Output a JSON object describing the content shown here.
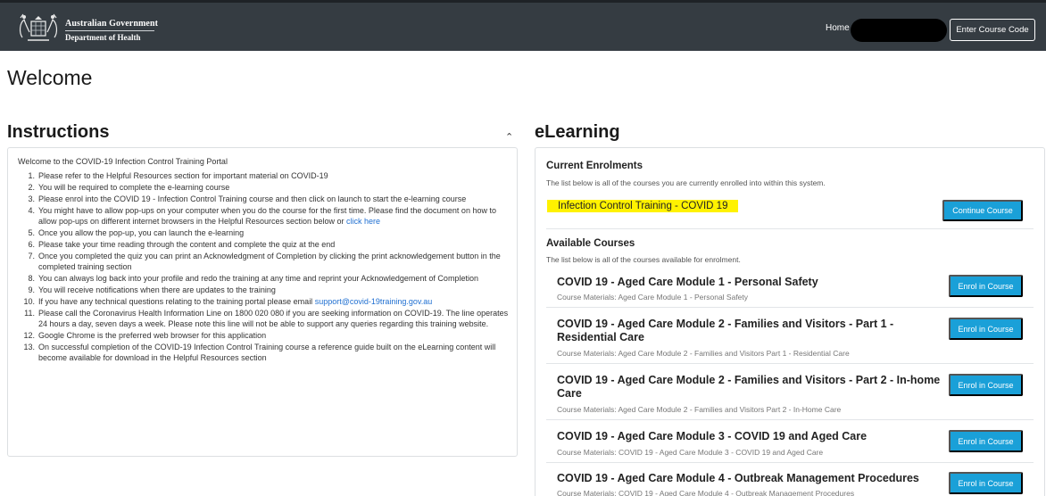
{
  "header": {
    "gov_line1": "Australian Government",
    "gov_line2": "Department of Health",
    "home_label": "Home",
    "enter_code_label": "Enter Course Code"
  },
  "page_title": "Welcome",
  "instructions": {
    "title": "Instructions",
    "collapse_icon": "chevron-up",
    "intro": "Welcome to the COVID-19 Infection Control Training Portal",
    "items": [
      {
        "num": "1.",
        "text": "Please refer to the Helpful Resources section for important material on COVID-19"
      },
      {
        "num": "2.",
        "text": "You will be required to complete the e-learning course"
      },
      {
        "num": "3.",
        "text": "Please enrol into the COVID 19 - Infection Control Training course and then click on launch to start the e-learning course"
      },
      {
        "num": "4.",
        "text": "You might have to allow pop-ups on your computer when you do the course for the first time. Please find the document on how to allow pop-ups on different internet browsers in the Helpful Resources section below or ",
        "link": "click here"
      },
      {
        "num": "5.",
        "text": "Once you allow the pop-up, you can launch the e-learning"
      },
      {
        "num": "6.",
        "text": "Please take your time reading through the content and complete the quiz at the end"
      },
      {
        "num": "7.",
        "text": "Once you completed the quiz you can print an Acknowledgment of Completion by clicking the print acknowledgement button in the completed training section"
      },
      {
        "num": "8.",
        "text": "You can always log back into your profile and redo the training at any time and reprint your Acknowledgement of Completion"
      },
      {
        "num": "9.",
        "text": "You will receive notifications when there are updates to the training"
      },
      {
        "num": "10.",
        "text": "If you have any technical questions relating to the training portal please email ",
        "link": "support@covid-19training.gov.au"
      },
      {
        "num": "11.",
        "text": "Please call the Coronavirus Health Information Line on 1800 020 080 if you are seeking information on COVID-19. The line operates 24 hours a day, seven days a week. Please note this line will not be able to support any queries regarding this training website."
      },
      {
        "num": "12.",
        "text": "Google Chrome is the preferred web browser for this application"
      },
      {
        "num": "13.",
        "text": "On successful completion of the COVID-19 Infection Control Training course a reference guide built on the eLearning content will become available for download in the Helpful Resources section"
      }
    ]
  },
  "elearning": {
    "title": "eLearning",
    "current_heading": "Current Enrolments",
    "current_note": "The list below is all of the courses you are currently enrolled into within this system.",
    "current_course": "Infection Control Training - COVID 19",
    "continue_label": "Continue Course",
    "available_heading": "Available Courses",
    "available_note": "The list below is all of the courses available for enrolment.",
    "enrol_label": "Enrol in Course",
    "courses": [
      {
        "title": "COVID 19 - Aged Care Module 1 - Personal Safety",
        "materials": "Course Materials: Aged Care Module 1 - Personal Safety"
      },
      {
        "title": "COVID 19 - Aged Care Module 2 - Families and Visitors - Part 1 - Residential Care",
        "materials": "Course Materials: Aged Care Module 2 - Families and Visitors Part 1 - Residential Care"
      },
      {
        "title": "COVID 19 - Aged Care Module 2 - Families and Visitors - Part 2 - In-home Care",
        "materials": "Course Materials: Aged Care Module 2 - Families and Visitors Part 2 - In-Home Care"
      },
      {
        "title": "COVID 19 - Aged Care Module 3 - COVID 19 and Aged Care",
        "materials": "Course Materials: COVID 19 - Aged Care Module 3 - COVID 19 and Aged Care"
      },
      {
        "title": "COVID 19 - Aged Care Module 4 - Outbreak Management Procedures",
        "materials": "Course Materials: COVID 19 - Aged Care Module 4 - Outbreak Management Procedures"
      }
    ]
  },
  "colors": {
    "header_bg": "#353c42",
    "button_blue": "#1aa0d8",
    "highlight_yellow": "#fff200",
    "link_blue": "#1f6fd1"
  }
}
